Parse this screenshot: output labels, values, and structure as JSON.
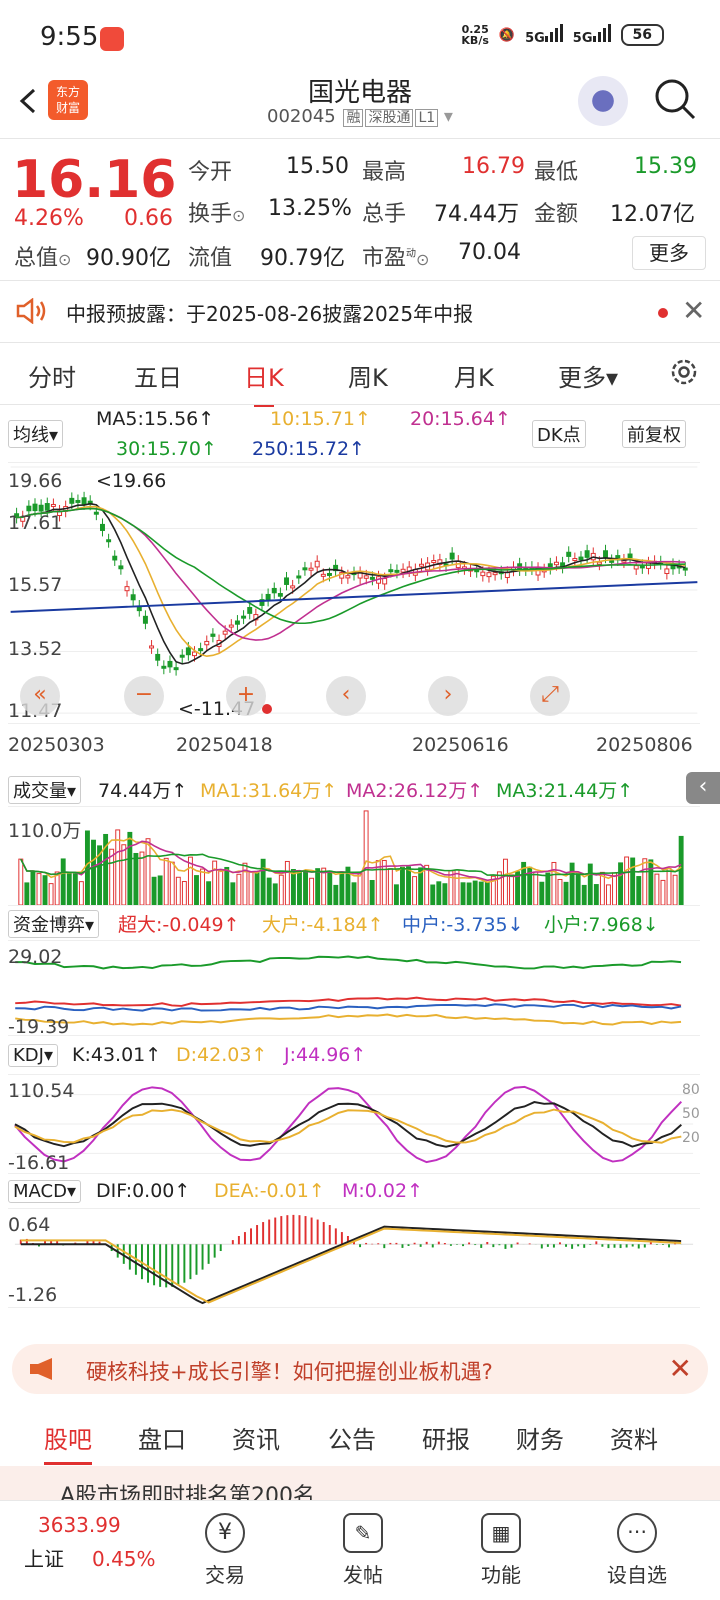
{
  "status": {
    "time": "9:55",
    "speed": "0.25\nKB/s",
    "speed_top": "0.25",
    "speed_bottom": "KB/s",
    "net1": "5G",
    "net2": "5G",
    "battery": "56"
  },
  "header": {
    "title": "国光电器",
    "code": "002045",
    "tags": [
      "融",
      "深股通",
      "L1"
    ],
    "logo_line1": "东方",
    "logo_line2": "财富"
  },
  "quote": {
    "price": "16.16",
    "pct": "4.26%",
    "change": "0.66",
    "open_label": "今开",
    "open": "15.50",
    "high_label": "最高",
    "high": "16.79",
    "low_label": "最低",
    "low": "15.39",
    "turnover_label": "换手",
    "turnover": "13.25%",
    "volume_label": "总手",
    "volume": "74.44万",
    "amount_label": "金额",
    "amount": "12.07亿",
    "mcap_label": "总值",
    "mcap": "90.90亿",
    "float_label": "流值",
    "float": "90.79亿",
    "pe_label": "市盈",
    "pe_sup": "动",
    "pe": "70.04",
    "more": "更多"
  },
  "notice": {
    "text": "中报预披露：于2025-08-26披露2025年中报"
  },
  "tabs": [
    "分时",
    "五日",
    "日K",
    "周K",
    "月K",
    "更多▾"
  ],
  "active_tab": "日K",
  "kline": {
    "ma_selector": "均线▾",
    "ma5": "MA5:15.56↑",
    "ma10": "10:15.71↑",
    "ma20": "20:15.64↑",
    "ma30": "30:15.70↑",
    "ma250": "250:15.72↑",
    "dk": "DK点",
    "adjust": "前复权",
    "y_ticks": [
      "19.66",
      "17.61",
      "15.57",
      "13.52",
      "11.47"
    ],
    "high_mark": "<19.66",
    "low_mark": "<-11.47",
    "dates": [
      "20250303",
      "20250418",
      "20250616",
      "20250806"
    ],
    "ctrl": [
      "«",
      "−",
      "+",
      "‹",
      "›",
      "⤢"
    ]
  },
  "volume": {
    "selector": "成交量▾",
    "value": "74.44万↑",
    "ma1": "MA1:31.64万↑",
    "ma2": "MA2:26.12万↑",
    "ma3": "MA3:21.44万↑",
    "ytop": "110.0万"
  },
  "flow": {
    "selector": "资金博弈▾",
    "super": "超大:-0.049↑",
    "large": "大户:-4.184↑",
    "mid": "中户:-3.735↓",
    "small": "小户:7.968↓",
    "ytop": "29.02",
    "ybot": "-19.39"
  },
  "kdj": {
    "selector": "KDJ▾",
    "k": "K:43.01↑",
    "d": "D:42.03↑",
    "j": "J:44.96↑",
    "ytop": "110.54",
    "ybot": "-16.61",
    "levels": [
      "80",
      "50",
      "20"
    ]
  },
  "macd": {
    "selector": "MACD▾",
    "dif": "DIF:0.00↑",
    "dea": "DEA:-0.01↑",
    "m": "M:0.02↑",
    "ytop": "0.64",
    "ybot": "-1.26"
  },
  "promo": {
    "text": "硬核科技+成长引擎！如何把握创业板机遇?"
  },
  "bottom_tabs": [
    "股吧",
    "盘口",
    "资讯",
    "公告",
    "研报",
    "财务",
    "资料"
  ],
  "peek_text": "A股市场即时排名第200名",
  "bottombar": {
    "index_value": "3633.99",
    "index_name": "上证",
    "index_pct": "0.45%",
    "items": [
      "交易",
      "发帖",
      "功能",
      "设自选"
    ]
  },
  "colors": {
    "up": "#e03030",
    "down": "#1a9a2a",
    "accent": "#f35b2b"
  }
}
